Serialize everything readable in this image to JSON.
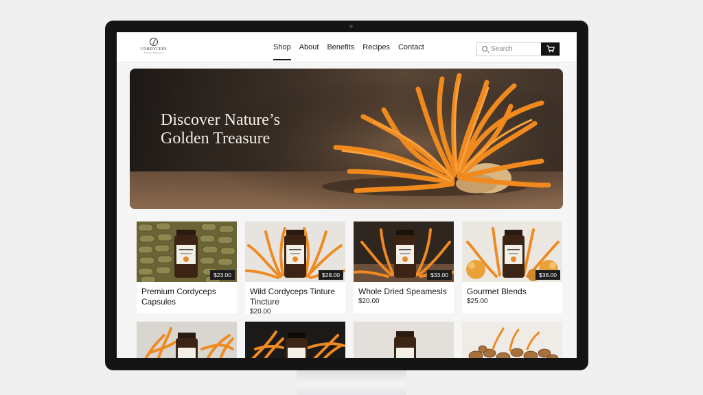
{
  "brand": {
    "logo_text": "CORDYCEPS",
    "logo_sub": "Premium Mushrooms"
  },
  "nav": {
    "items": [
      {
        "label": "Shop",
        "active": true
      },
      {
        "label": "About",
        "active": false
      },
      {
        "label": "Benefits",
        "active": false
      },
      {
        "label": "Recipes",
        "active": false
      },
      {
        "label": "Contact",
        "active": false
      }
    ]
  },
  "search": {
    "placeholder": "Search",
    "icon": "search-icon"
  },
  "cart": {
    "icon": "cart-icon",
    "glyph": "🛒"
  },
  "hero": {
    "title_line1": "Discover Nature’s",
    "title_line2": "Golden Treasure"
  },
  "products": [
    {
      "title": "Premium Cordyceps Capsules",
      "price": "",
      "badge": "$23.00"
    },
    {
      "title": "Wild Cordyceps Tinture Tincture",
      "price": "$20.00",
      "badge": "$28.00"
    },
    {
      "title": "Whole Dried Speamesls",
      "price": "$20.00",
      "badge": "$33.00"
    },
    {
      "title": "Gourmet Blends",
      "price": "$25.00",
      "badge": "$38.00"
    }
  ],
  "colors": {
    "accent": "#e8892a",
    "dark": "#141414",
    "background": "#f5f5f5"
  }
}
